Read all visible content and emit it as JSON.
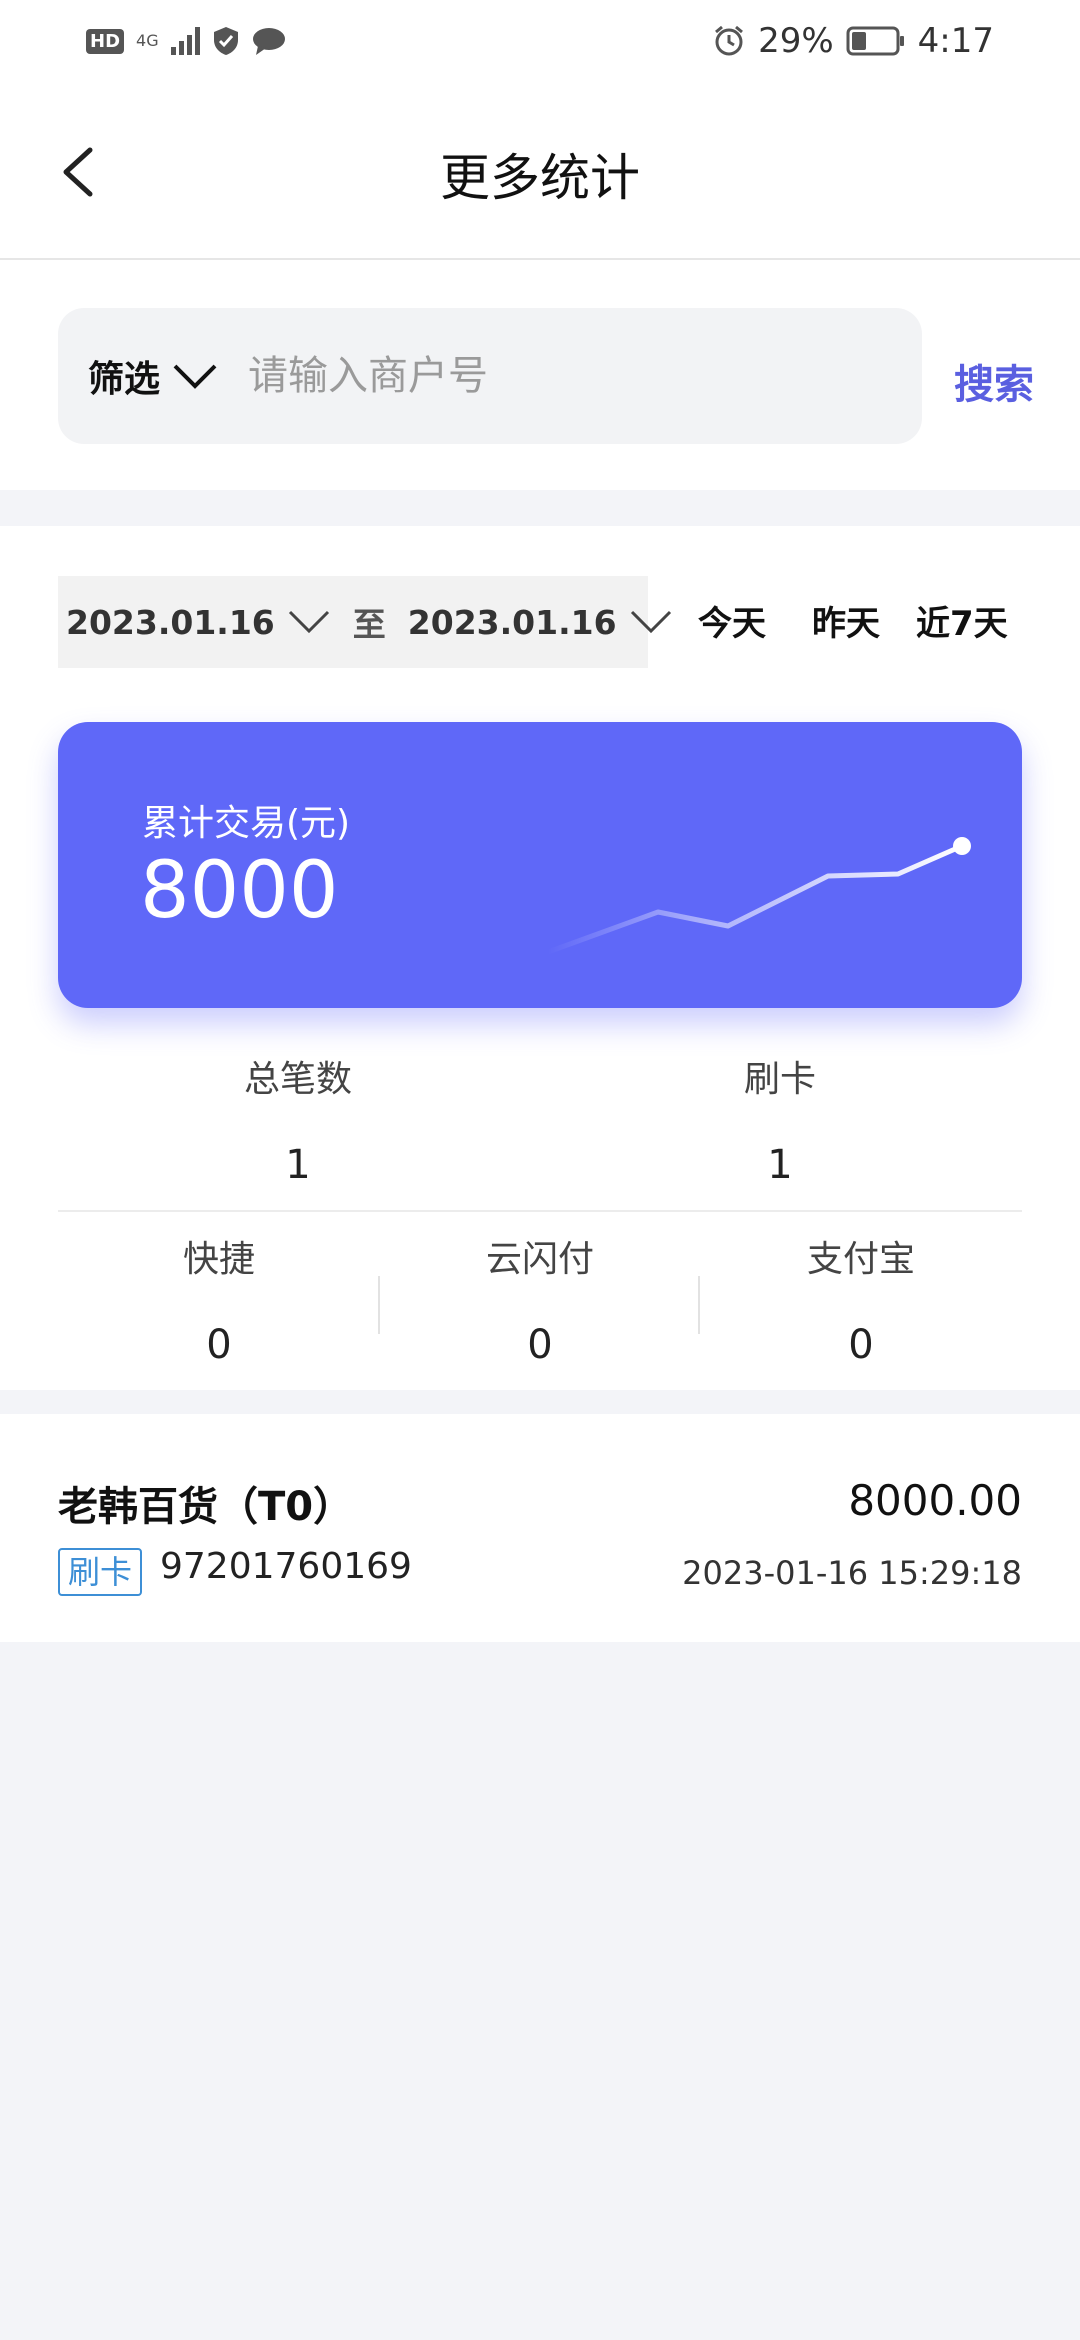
{
  "status_bar": {
    "network_label": "4G",
    "battery_percent": "29%",
    "time": "4:17",
    "icons": [
      "hd-icon",
      "signal-icon",
      "shield-icon",
      "message-icon",
      "alarm-icon",
      "battery-icon"
    ]
  },
  "app_bar": {
    "title": "更多统计"
  },
  "search": {
    "filter_label": "筛选",
    "placeholder": "请输入商户号",
    "search_label": "搜索"
  },
  "date_filter": {
    "start_date": "2023.01.16",
    "separator": "至",
    "end_date": "2023.01.16",
    "quick_options": [
      "今天",
      "昨天",
      "近7天"
    ]
  },
  "summary": {
    "label": "累计交易(元)",
    "value": "8000"
  },
  "stats": {
    "row1": [
      {
        "label": "总笔数",
        "value": "1"
      },
      {
        "label": "刷卡",
        "value": "1"
      }
    ],
    "row2": [
      {
        "label": "快捷",
        "value": "0"
      },
      {
        "label": "云闪付",
        "value": "0"
      },
      {
        "label": "支付宝",
        "value": "0"
      }
    ]
  },
  "transactions": [
    {
      "merchant": "老韩百货（T0）",
      "type": "刷卡",
      "merchant_no": "97201760169",
      "amount": "8000.00",
      "time": "2023-01-16 15:29:18"
    }
  ],
  "colors": {
    "accent": "#5f68f8",
    "search_text": "#5a5fe0",
    "badge": "#3d8fd6",
    "background": "#f3f4f8"
  }
}
